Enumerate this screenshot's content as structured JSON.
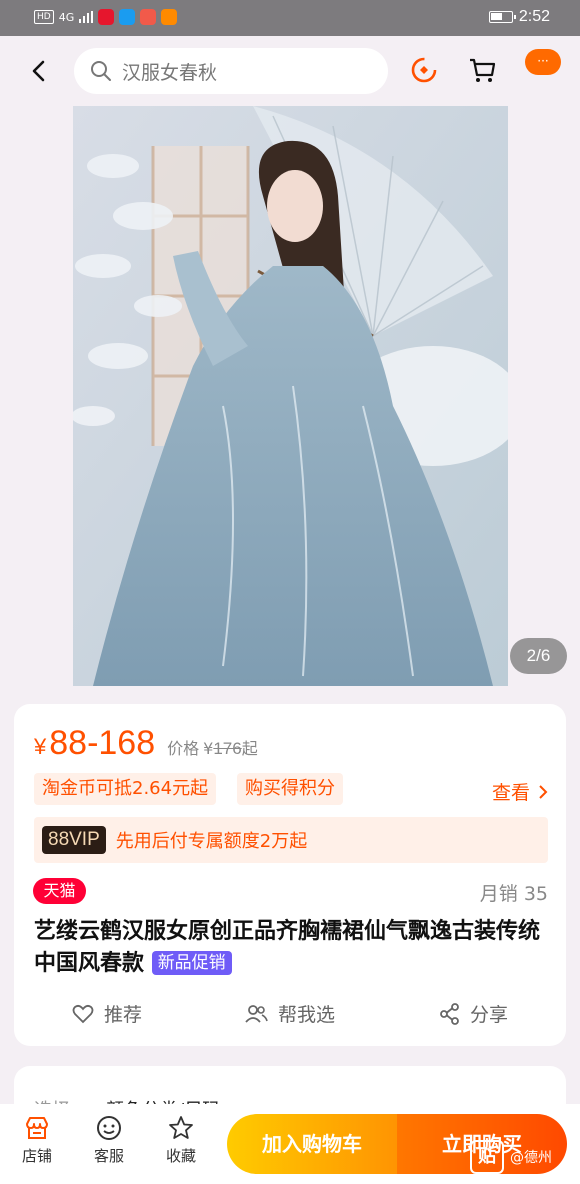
{
  "status_bar": {
    "hd": "HD",
    "network": "4G",
    "time": "2:52"
  },
  "nav": {
    "search_text": "汉服女春秋",
    "more": "···"
  },
  "gallery": {
    "counter": "2/6"
  },
  "price": {
    "currency": "¥",
    "value": "88-168",
    "orig_label": "价格",
    "orig_currency": "¥",
    "orig_value": "176",
    "orig_suffix": "起"
  },
  "promos": {
    "tag1": "淘金币可抵2.64元起",
    "tag2": "购买得积分",
    "see": "查看"
  },
  "vip": {
    "badge": "88VIP",
    "text": "先用后付专属额度2万起"
  },
  "shop": {
    "badge": "天猫",
    "monthly_sales": "月销 35"
  },
  "title": {
    "text": "艺缕云鹤汉服女原创正品齐胸襦裙仙气飘逸古装传统中国风春款",
    "badge": "新品促销"
  },
  "actions": {
    "recommend": "推荐",
    "help_choose": "帮我选",
    "share": "分享"
  },
  "options_card": {
    "label": "选择",
    "value": "颜色分类/尺码"
  },
  "bottom_bar": {
    "store": "店铺",
    "service": "客服",
    "favorite": "收藏",
    "add_to_cart": "加入购物车",
    "buy_now": "立即购买"
  },
  "watermark": {
    "logo": "贴",
    "text": "@德州"
  },
  "colors": {
    "accent": "#ff5000",
    "tmall": "#ff0036",
    "new_badge": "#6f5cf7"
  }
}
